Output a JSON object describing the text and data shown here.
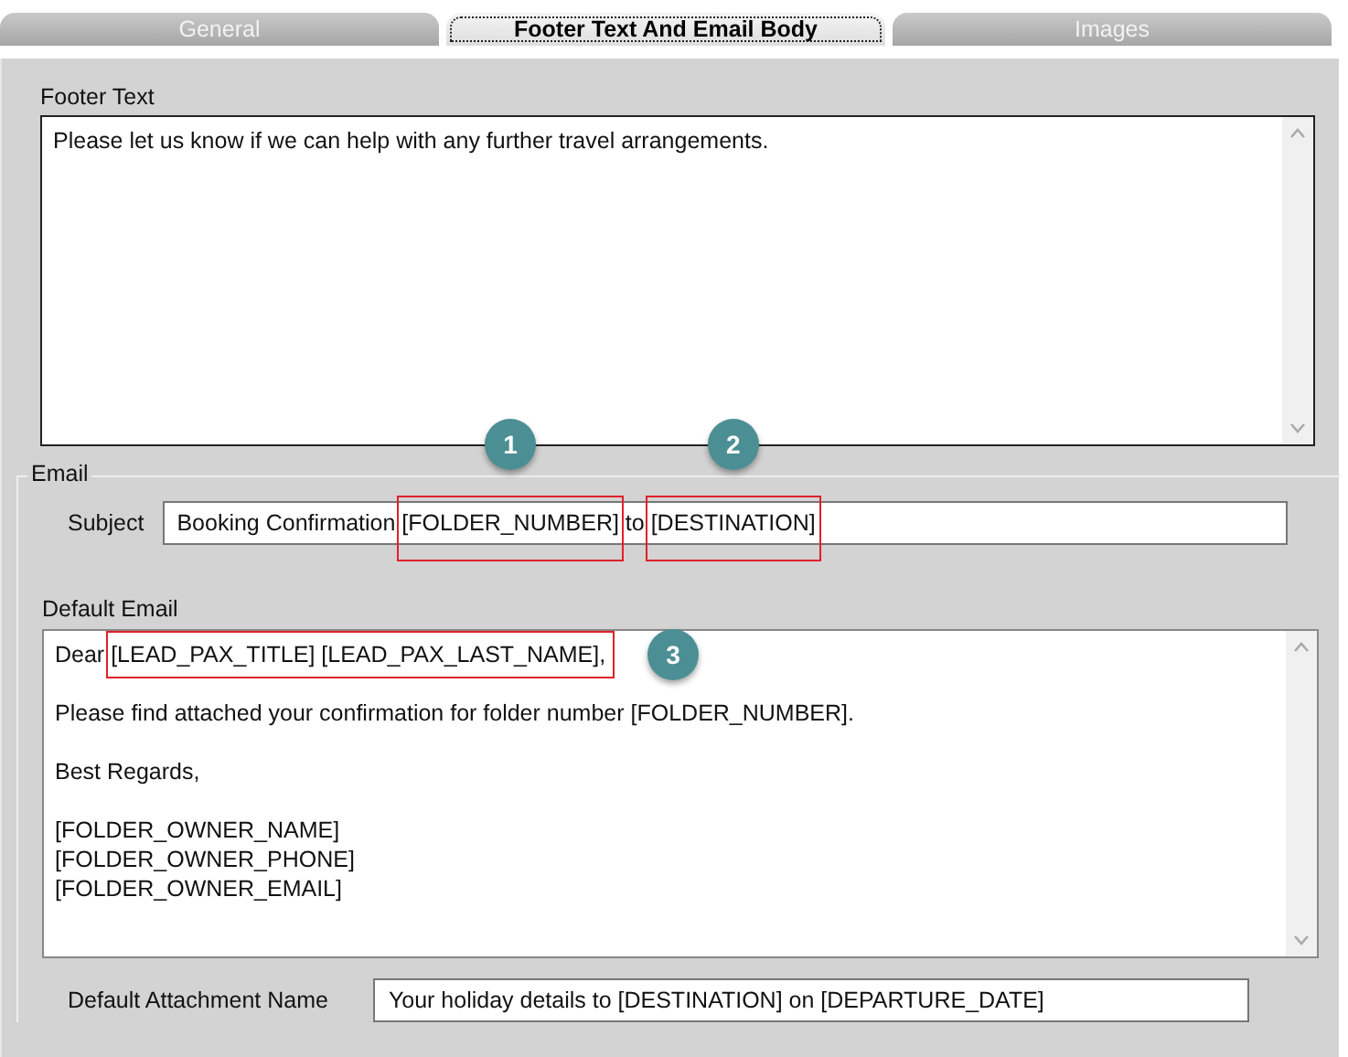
{
  "tabs": [
    {
      "label": "General",
      "selected": false
    },
    {
      "label": "Footer Text And Email Body",
      "selected": true
    },
    {
      "label": "Images",
      "selected": false
    }
  ],
  "footer_text": {
    "label": "Footer Text",
    "value": "Please let us know if we can help with any further travel arrangements."
  },
  "email": {
    "title": "Email",
    "subject_label": "Subject",
    "subject_segments": [
      {
        "text": "Booking Confirmation "
      },
      {
        "text": "[FOLDER_NUMBER]",
        "callout": "1"
      },
      {
        "text": " to "
      },
      {
        "text": "[DESTINATION]",
        "callout": "2"
      }
    ]
  },
  "default_email": {
    "label": "Default Email",
    "segments": [
      {
        "text": "Dear "
      },
      {
        "text": "[LEAD_PAX_TITLE] [LEAD_PAX_LAST_NAME],",
        "callout": "3"
      },
      {
        "text": "\n\nPlease find attached your confirmation for folder number [FOLDER_NUMBER].\n\nBest Regards,\n\n[FOLDER_OWNER_NAME]\n[FOLDER_OWNER_PHONE]\n[FOLDER_OWNER_EMAIL]"
      }
    ]
  },
  "attachment": {
    "label": "Default Attachment Name",
    "value": "Your holiday details to [DESTINATION] on [DEPARTURE_DATE]"
  }
}
